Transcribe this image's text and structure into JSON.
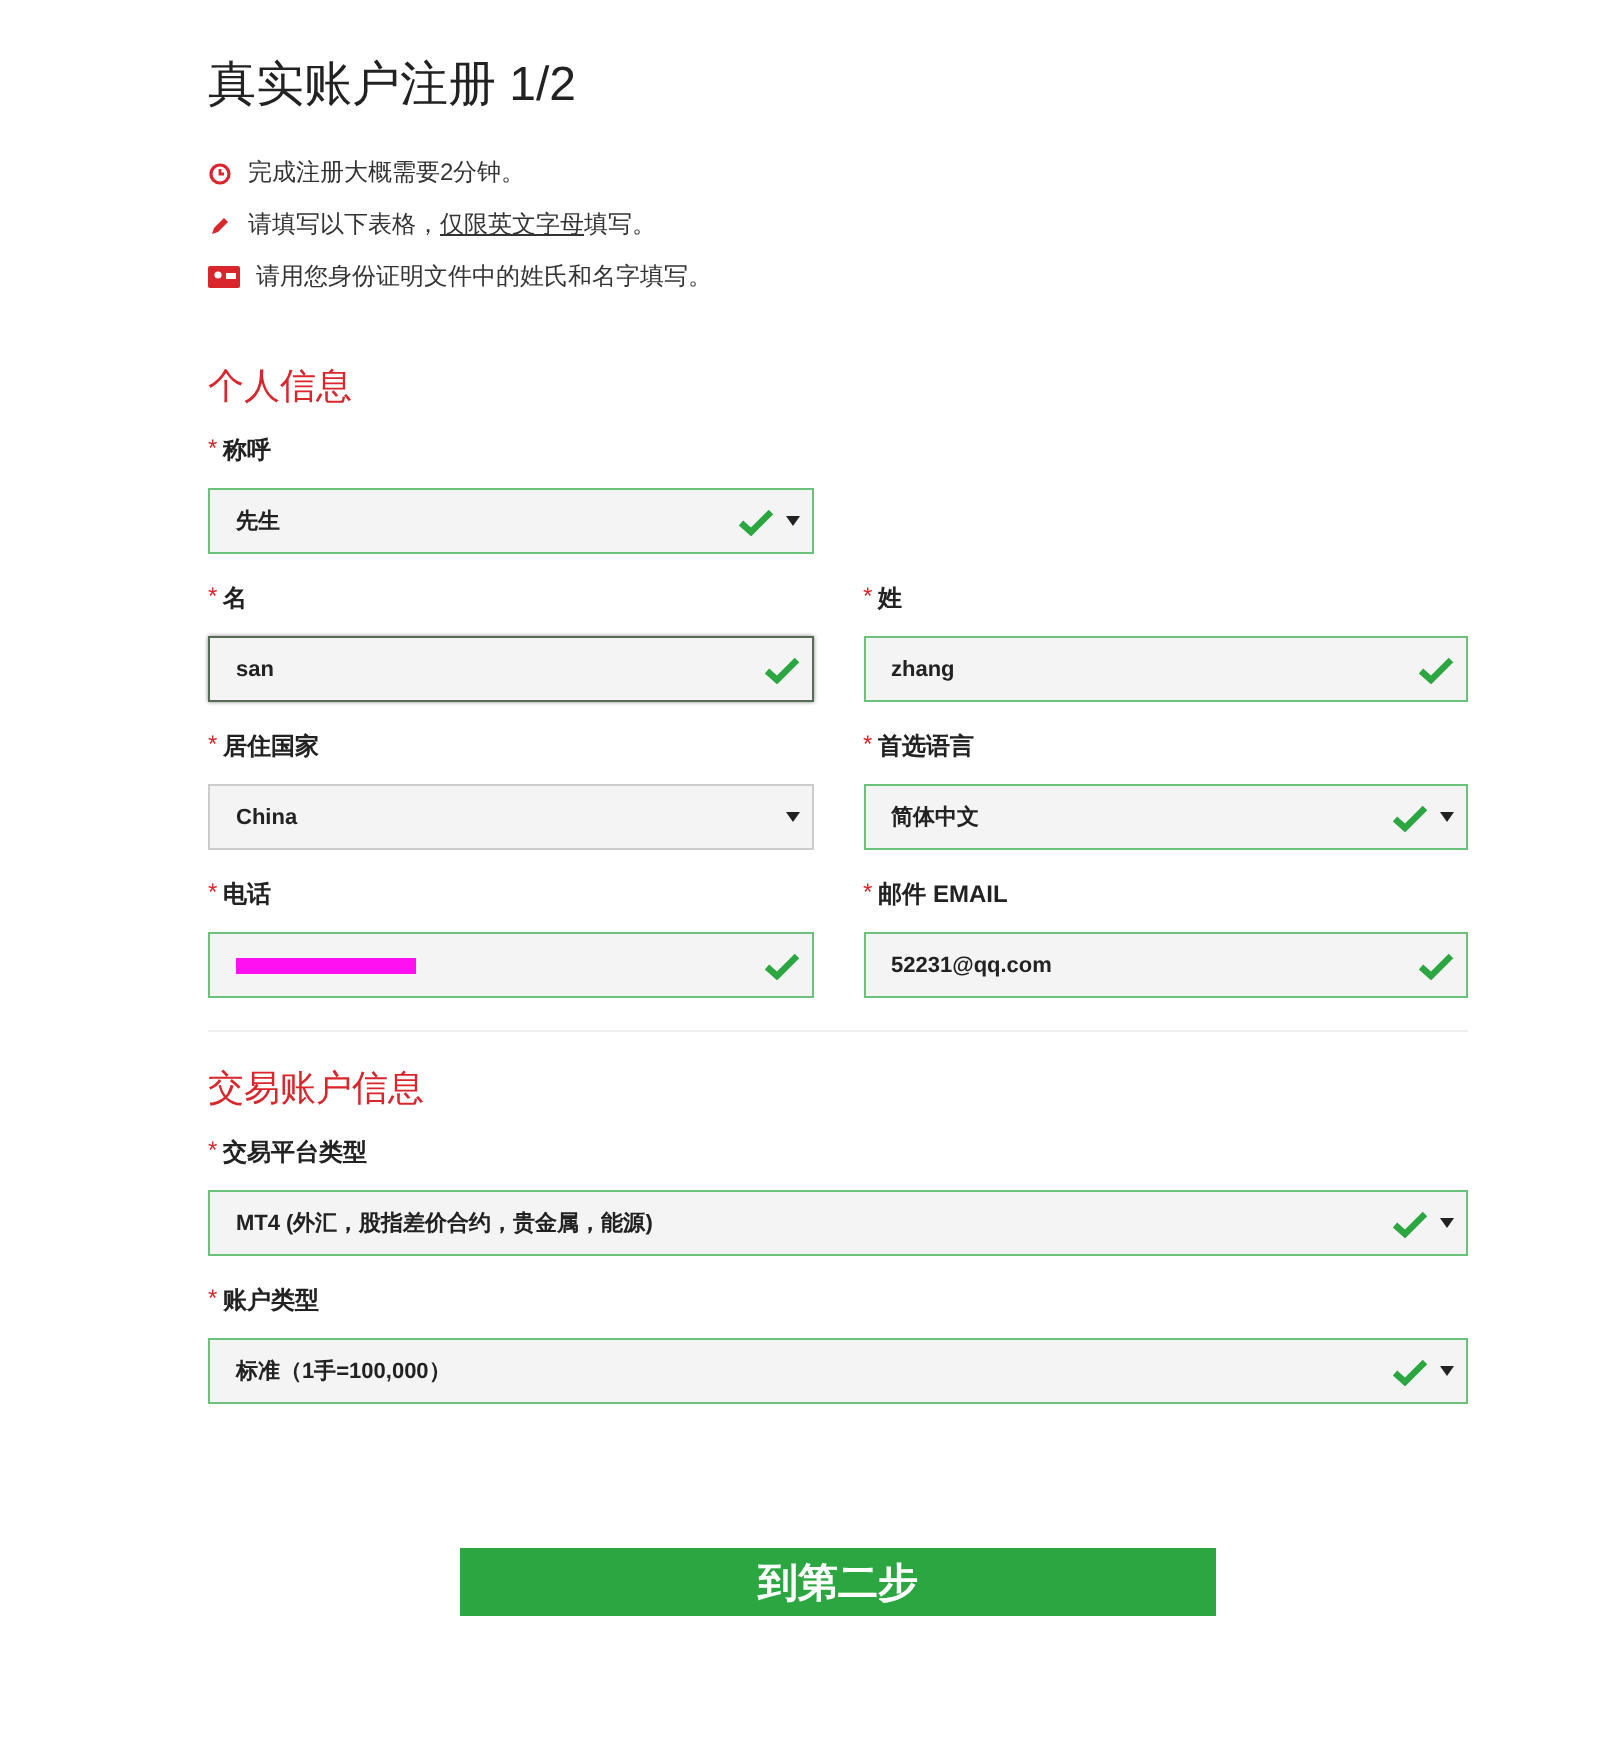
{
  "title": "真实账户注册 1/2",
  "notes": [
    {
      "parts": [
        {
          "kind": "text",
          "text": "完成注册大概需要2分钟。"
        }
      ]
    },
    {
      "parts": [
        {
          "kind": "text",
          "text": "请填写以下表格，"
        },
        {
          "kind": "link",
          "text": "仅限英文字母"
        },
        {
          "kind": "text",
          "text": "填写。"
        }
      ]
    },
    {
      "parts": [
        {
          "kind": "text",
          "text": "请用您身份证明文件中的姓氏和名字填写。"
        }
      ]
    }
  ],
  "sections": [
    {
      "title": "个人信息",
      "kind": "grid",
      "rows": [
        [
          {
            "marker": "*",
            "label": "称呼",
            "kind": "select",
            "value": "先生",
            "valid": true,
            "focused": false
          }
        ],
        [
          {
            "marker": "*",
            "label": "名",
            "kind": "input",
            "value": "san",
            "valid": true,
            "focused": true
          },
          {
            "marker": "*",
            "label": "姓",
            "kind": "input",
            "value": "zhang",
            "valid": true,
            "focused": false
          }
        ],
        [
          {
            "marker": "*",
            "label": "居住国家",
            "kind": "select",
            "value": "China",
            "valid": false,
            "focused": false
          },
          {
            "marker": "*",
            "label": "首选语言",
            "kind": "select",
            "value": "简体中文",
            "valid": true,
            "focused": false
          }
        ],
        [
          {
            "marker": "*",
            "label": "电话",
            "kind": "input",
            "redacted": true,
            "valid": true,
            "focused": false
          },
          {
            "marker": "*",
            "label": "邮件 EMAIL",
            "kind": "input",
            "value": "52231@qq.com",
            "valid": true,
            "focused": false
          }
        ]
      ]
    },
    {
      "title": "交易账户信息",
      "kind": "stack",
      "rows": [
        [
          {
            "marker": "*",
            "label": "交易平台类型",
            "kind": "select",
            "value": "MT4 (外汇，股指差价合约，贵金属，能源)",
            "valid": true,
            "focused": false
          }
        ],
        [
          {
            "marker": "*",
            "label": "账户类型",
            "kind": "select",
            "value": "标准（1手=100,000）",
            "valid": true,
            "focused": false
          }
        ]
      ]
    }
  ],
  "submit": "到第二步"
}
